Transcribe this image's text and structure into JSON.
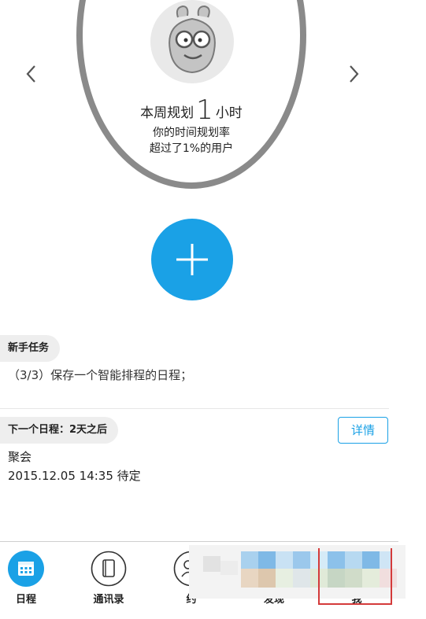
{
  "summary": {
    "week_prefix": "本周规划",
    "week_hours": "1",
    "week_suffix": "小时",
    "rate_line": "你的时间规划率",
    "exceed_line": "超过了1%的用户"
  },
  "tasks": {
    "badge": "新手任务",
    "text": "（3/3）保存一个智能排程的日程；"
  },
  "next_event": {
    "badge": "下一个日程：2天之后",
    "detail_button": "详情",
    "title": "聚会",
    "time": "2015.12.05 14:35 待定"
  },
  "nav": {
    "items": [
      {
        "label": "日程",
        "icon": "calendar-icon",
        "active": true
      },
      {
        "label": "通讯录",
        "icon": "contacts-icon",
        "active": false
      },
      {
        "label": "约",
        "icon": "people-icon",
        "active": false
      },
      {
        "label": "发现",
        "icon": "discover-icon",
        "active": false
      },
      {
        "label": "我",
        "icon": "person-icon",
        "active": false
      }
    ]
  },
  "colors": {
    "accent": "#1aa1e6",
    "ring": "#8a8a8a",
    "highlight": "#d43a3a"
  }
}
